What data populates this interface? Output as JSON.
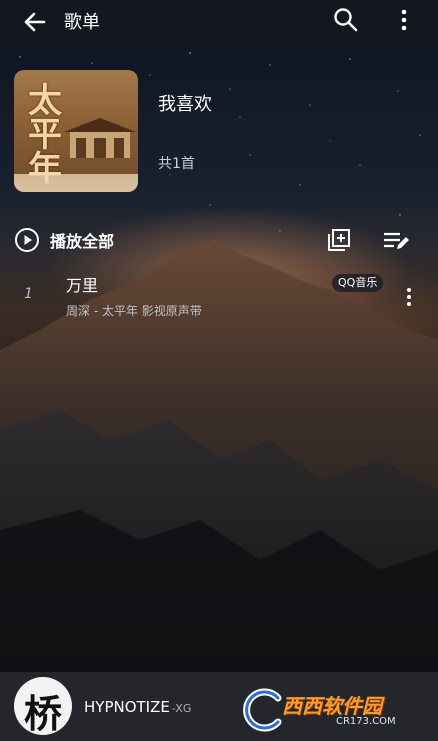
{
  "header": {
    "title": "歌单",
    "icons": {
      "back": "arrow-left-icon",
      "search": "search-icon",
      "more": "more-vertical-icon"
    }
  },
  "playlist": {
    "cover_text": "太平年",
    "name": "我喜欢",
    "count_text": "共1首"
  },
  "actions": {
    "play_all_label": "播放全部",
    "icons": {
      "play": "play-circle-icon",
      "add": "add-to-playlist-icon",
      "manage": "edit-list-icon"
    }
  },
  "songs": [
    {
      "index": "1",
      "title": "万里",
      "subtitle": "周深 - 太平年 影视原声带",
      "source": "QQ音乐"
    }
  ],
  "player": {
    "title": "HYPNOTIZE",
    "artist": "-XG",
    "avatar_glyph": "桥"
  },
  "watermark": {
    "brand": "西西软件园",
    "domain": "CR173.COM"
  },
  "colors": {
    "accent": "#ffffff",
    "watermark_orange": "#ff9b2e"
  }
}
